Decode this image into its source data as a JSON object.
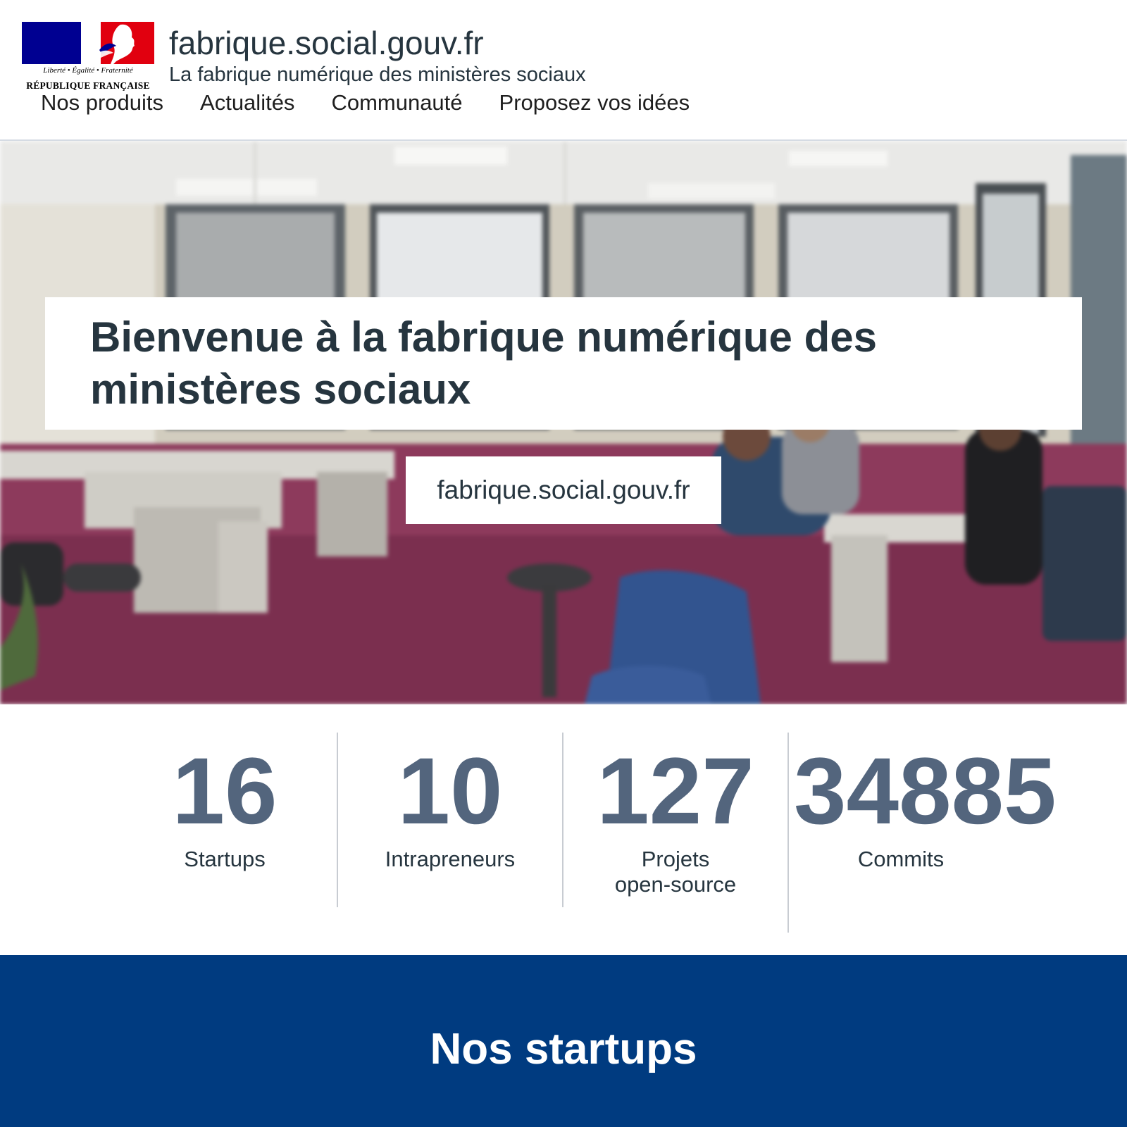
{
  "header": {
    "logo": {
      "motto": "Liberté • Égalité • Fraternité",
      "republic": "RÉPUBLIQUE FRANÇAISE",
      "colors": {
        "blue": "#000091",
        "white": "#ffffff",
        "red": "#e1000f"
      }
    },
    "title": "fabrique.social.gouv.fr",
    "subtitle": "La fabrique numérique des ministères sociaux",
    "nav": [
      {
        "label": "Nos produits"
      },
      {
        "label": "Actualités"
      },
      {
        "label": "Communauté"
      },
      {
        "label": "Proposez vos idées"
      }
    ]
  },
  "hero": {
    "background": "blurred-office-photo",
    "title": "Bienvenue à la fabrique numérique des ministères sociaux",
    "url_label": "fabrique.social.gouv.fr"
  },
  "stats": [
    {
      "value": "16",
      "label": "Startups"
    },
    {
      "value": "10",
      "label": "Intrapreneurs"
    },
    {
      "value": "127",
      "label": "Projets open-source"
    },
    {
      "value": "34885",
      "label": "Commits"
    }
  ],
  "startups_section": {
    "title": "Nos startups",
    "background_color": "#003b80"
  }
}
